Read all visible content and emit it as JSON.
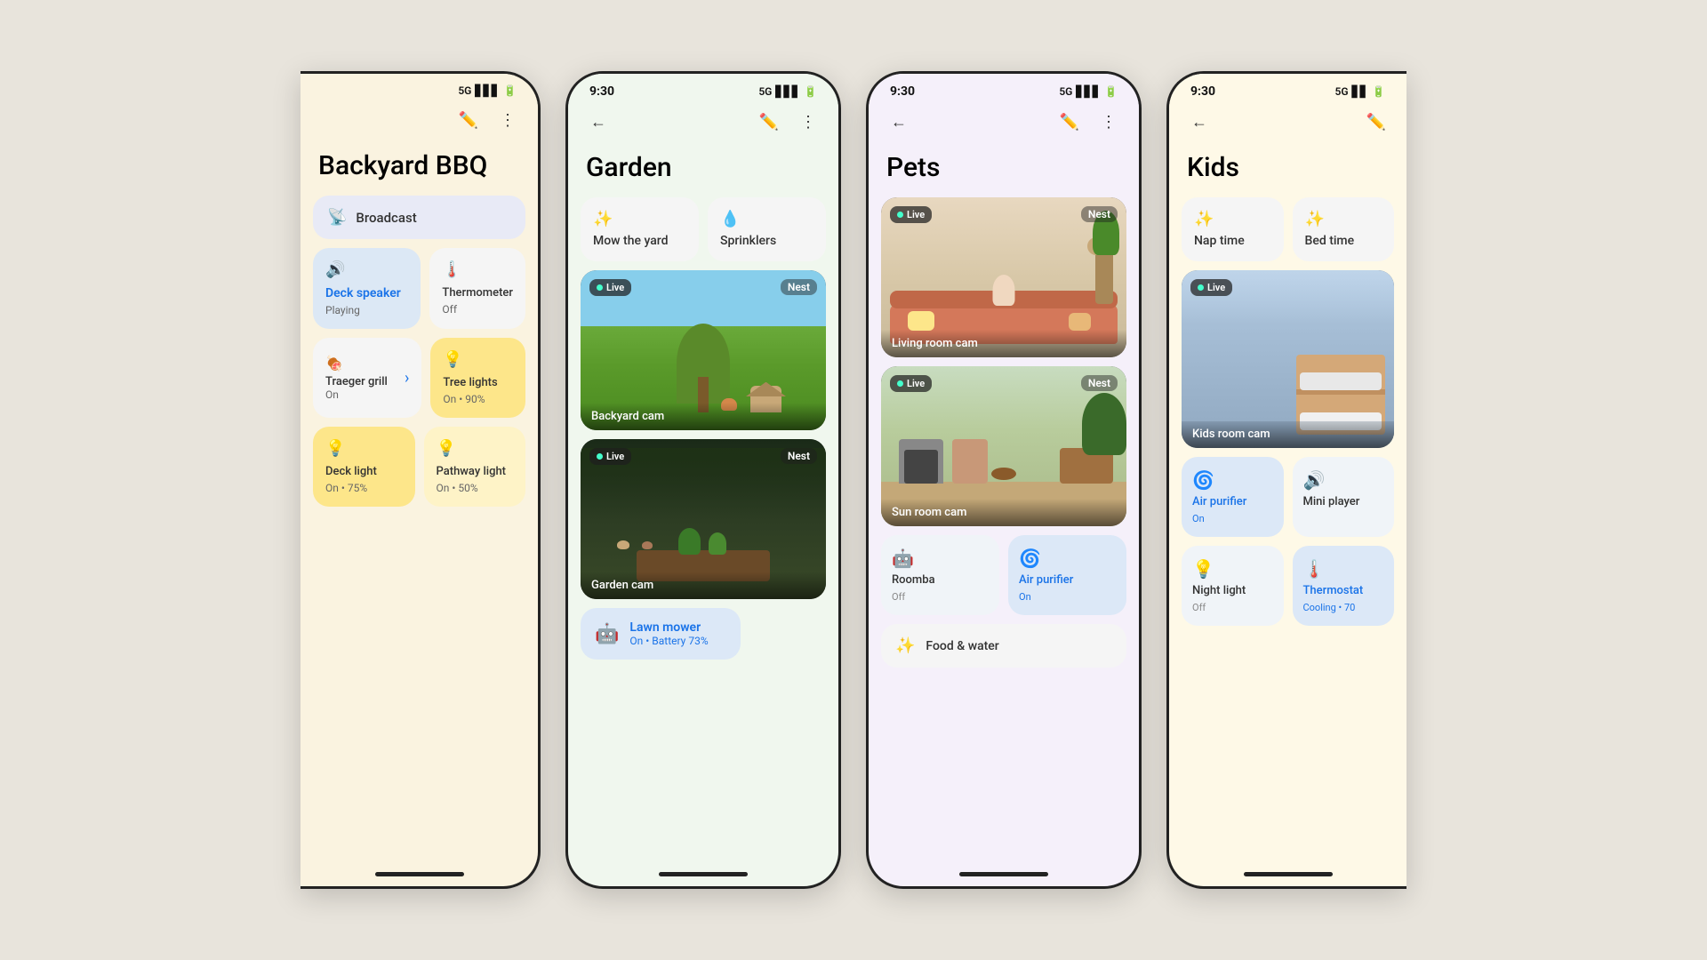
{
  "bgColor": "#e8e4dc",
  "phones": [
    {
      "id": "backyard-bbq",
      "theme": "phone1",
      "partial": "left",
      "statusBar": {
        "time": "",
        "signal": "5G",
        "showBattery": true
      },
      "title": "Backyard BBQ",
      "headerBg": "#faf3e0",
      "items": [
        {
          "type": "broadcast",
          "label": "Broadcast",
          "icon": "📡"
        },
        {
          "type": "row",
          "cards": [
            {
              "bg": "blue",
              "icon": "🔊",
              "label": "Deck speaker",
              "sub": "Playing",
              "arrow": true,
              "active": true
            },
            {
              "bg": "white",
              "icon": "🌡",
              "label": "Thermometer",
              "sub": "Off"
            }
          ]
        },
        {
          "type": "row",
          "cards": [
            {
              "bg": "white",
              "icon": "🍖",
              "label": "Traeger grill",
              "sub": "On",
              "arrow": true
            },
            {
              "bg": "yellow",
              "icon": "💡",
              "label": "Tree lights",
              "sub": "On • 90%"
            }
          ]
        },
        {
          "type": "row",
          "cards": [
            {
              "bg": "yellow",
              "icon": "💡",
              "label": "Deck light",
              "sub": "On • 75%"
            },
            {
              "bg": "yellow-light",
              "icon": "💡",
              "label": "Pathway light",
              "sub": "On • 50%"
            }
          ]
        }
      ]
    },
    {
      "id": "garden",
      "theme": "phone2",
      "partial": "none",
      "statusBar": {
        "time": "9:30",
        "signal": "5G",
        "showBattery": true
      },
      "title": "Garden",
      "headerBg": "#f0f7ee",
      "items": [
        {
          "type": "action-row",
          "cards": [
            {
              "icon": "✨",
              "label": "Mow the yard"
            },
            {
              "icon": "💧",
              "label": "Sprinklers"
            }
          ]
        },
        {
          "type": "camera",
          "scene": "backyard",
          "live": true,
          "nest": true,
          "label": "Backyard cam"
        },
        {
          "type": "camera",
          "scene": "garden",
          "live": true,
          "nest": true,
          "label": "Garden cam"
        },
        {
          "type": "mower",
          "icon": "🤖",
          "label": "Lawn mower",
          "sub": "On • Battery 73%"
        }
      ]
    },
    {
      "id": "pets",
      "theme": "phone3",
      "partial": "none",
      "statusBar": {
        "time": "9:30",
        "signal": "5G",
        "showBattery": true
      },
      "title": "Pets",
      "headerBg": "#f5f0fa",
      "items": [
        {
          "type": "camera",
          "scene": "livingroom",
          "live": true,
          "nest": true,
          "label": "Living room cam"
        },
        {
          "type": "camera",
          "scene": "sunroom",
          "live": true,
          "nest": true,
          "label": "Sun room cam"
        },
        {
          "type": "device-row",
          "cards": [
            {
              "bg": "white",
              "icon": "🤖",
              "label": "Roomba",
              "sub": "Off"
            },
            {
              "bg": "blue",
              "icon": "🌀",
              "label": "Air purifier",
              "sub": "On",
              "active": true
            }
          ]
        },
        {
          "type": "food-water",
          "icon": "✨",
          "label": "Food & water"
        }
      ]
    },
    {
      "id": "kids",
      "theme": "phone4",
      "partial": "right",
      "statusBar": {
        "time": "9:30",
        "signal": "5G",
        "showBattery": true
      },
      "title": "Kids",
      "headerBg": "#fef9e7",
      "items": [
        {
          "type": "nap-row",
          "cards": [
            {
              "icon": "✨",
              "label": "Nap time"
            },
            {
              "icon": "✨",
              "label": "Bed time"
            }
          ]
        },
        {
          "type": "camera",
          "scene": "kidsroom",
          "live": true,
          "nest": false,
          "label": "Kids room cam"
        },
        {
          "type": "device-row",
          "cards": [
            {
              "bg": "blue",
              "icon": "🌀",
              "label": "Air purifier",
              "sub": "On",
              "active": true
            },
            {
              "bg": "white",
              "icon": "🔊",
              "label": "Mini player",
              "sub": ""
            }
          ]
        },
        {
          "type": "device-row",
          "cards": [
            {
              "bg": "white",
              "icon": "💡",
              "label": "Night light",
              "sub": "Off"
            },
            {
              "bg": "blue",
              "icon": "🌡",
              "label": "Thermostat",
              "sub": "Cooling • 70",
              "active": true
            }
          ]
        }
      ]
    }
  ],
  "labels": {
    "live": "Live",
    "nest": "Nest",
    "back_arrow": "←",
    "edit_icon": "✏️",
    "more_icon": "⋮"
  }
}
